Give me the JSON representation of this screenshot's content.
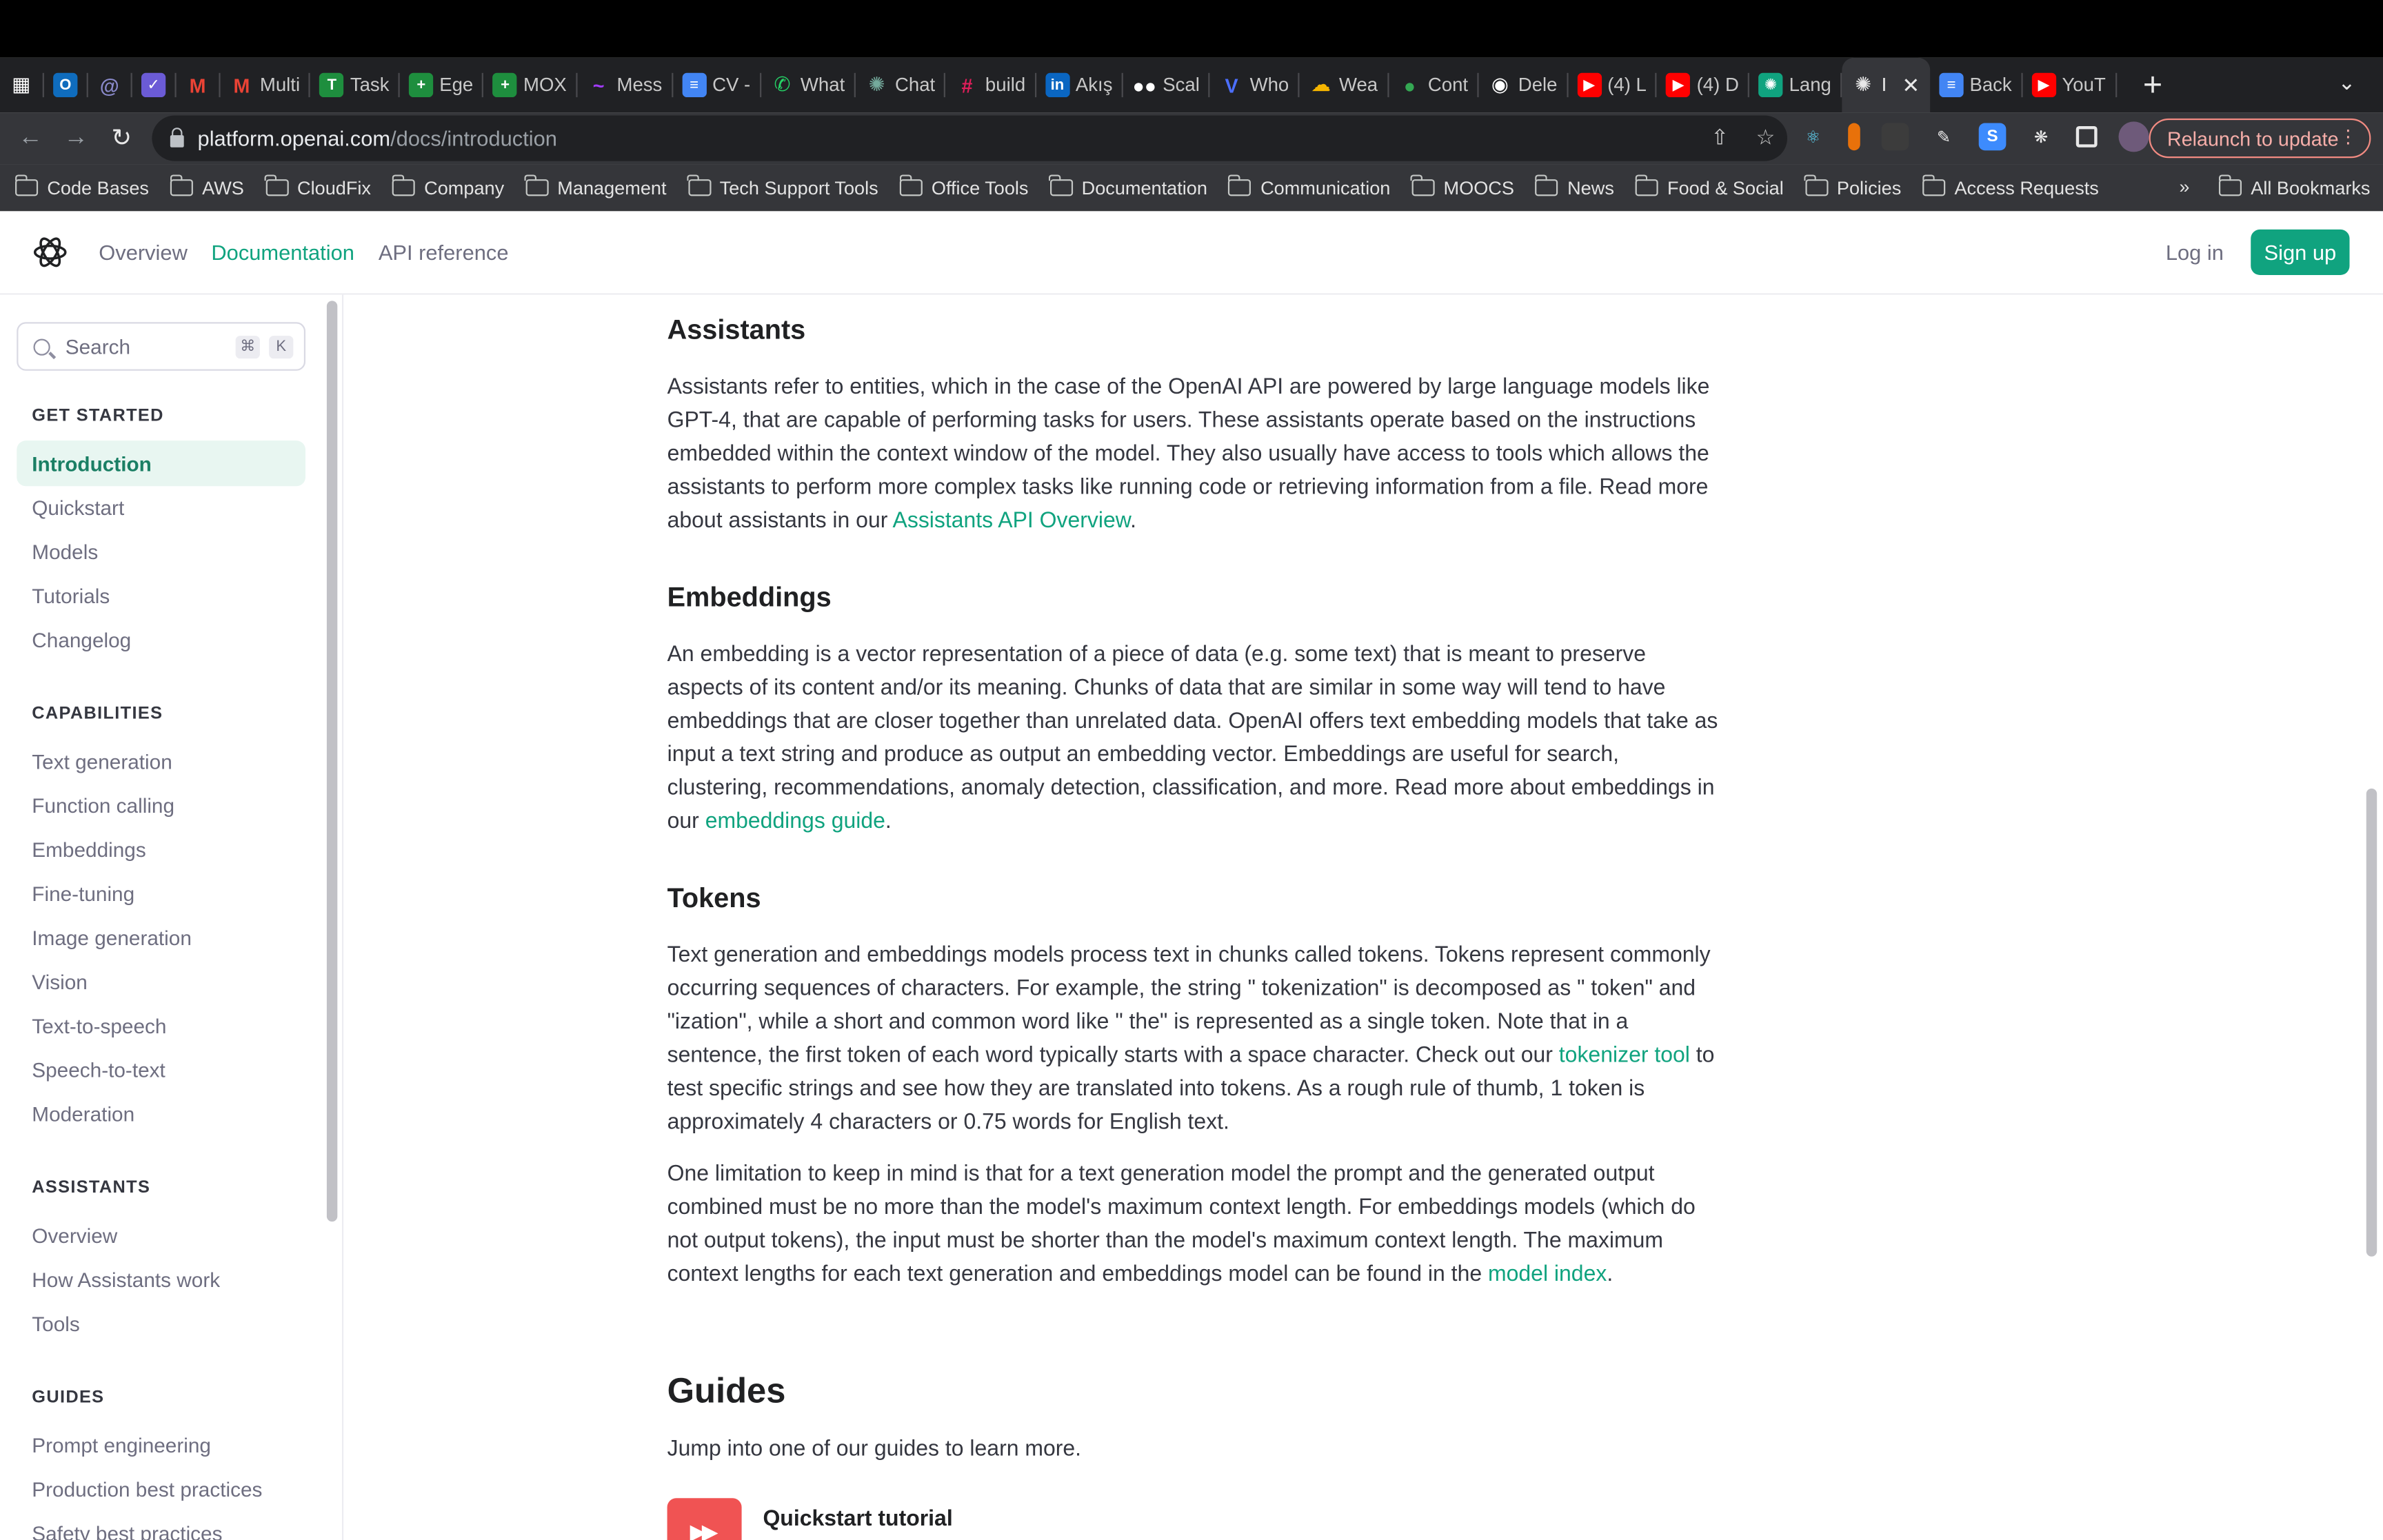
{
  "browser": {
    "tabs": [
      {
        "label": "",
        "icon": "grid-apps-icon",
        "color": "#ffffff"
      },
      {
        "label": "",
        "icon": "outlook-icon",
        "color": "#0f6cbd"
      },
      {
        "label": "",
        "icon": "spiral-icon",
        "color": "#8a8acb"
      },
      {
        "label": "",
        "icon": "check-circle-icon",
        "color": "#6b5bd6"
      },
      {
        "label": "",
        "icon": "gmail-icon",
        "color": "#ea4335"
      },
      {
        "label": "Multi",
        "icon": "gmail-icon",
        "color": "#ea4335"
      },
      {
        "label": "Task",
        "icon": "sheet-t-icon",
        "color": "#1e8e3e"
      },
      {
        "label": "Ege",
        "icon": "sheets-plus-icon",
        "color": "#1e8e3e"
      },
      {
        "label": "MOX",
        "icon": "sheets-plus-icon",
        "color": "#1e8e3e"
      },
      {
        "label": "Mess",
        "icon": "messenger-icon",
        "color": "#a33bff"
      },
      {
        "label": "CV -",
        "icon": "docs-icon",
        "color": "#4285f4"
      },
      {
        "label": "What",
        "icon": "whatsapp-icon",
        "color": "#25d366"
      },
      {
        "label": "Chat",
        "icon": "chatgpt-icon",
        "color": "#74aa9c"
      },
      {
        "label": "build",
        "icon": "slack-icon",
        "color": "#e01e5a"
      },
      {
        "label": "Akış",
        "icon": "linkedin-icon",
        "color": "#0a66c2"
      },
      {
        "label": "Scal",
        "icon": "medium-icon",
        "color": "#ffffff"
      },
      {
        "label": "Who",
        "icon": "check-v-icon",
        "color": "#4c6fff"
      },
      {
        "label": "Wea",
        "icon": "weather-icon",
        "color": "#f4b400"
      },
      {
        "label": "Cont",
        "icon": "green-dot-icon",
        "color": "#34a853"
      },
      {
        "label": "Dele",
        "icon": "github-icon",
        "color": "#ffffff"
      },
      {
        "label": "(4) L",
        "icon": "youtube-icon",
        "color": "#ff0000"
      },
      {
        "label": "(4) D",
        "icon": "youtube-icon",
        "color": "#ff0000"
      },
      {
        "label": "Lang",
        "icon": "chatgpt-green-icon",
        "color": "#10a37f"
      }
    ],
    "active_tab": {
      "label": "I",
      "icon": "openai-icon"
    },
    "tabs_after": [
      {
        "label": "Back",
        "icon": "docs-icon",
        "color": "#4285f4"
      },
      {
        "label": "YouT",
        "icon": "youtube-icon",
        "color": "#ff0000"
      }
    ],
    "url_host": "platform.openai.com",
    "url_path": "/docs/introduction",
    "relaunch_label": "Relaunch to update",
    "bookmarks": [
      "Code Bases",
      "AWS",
      "CloudFix",
      "Company",
      "Management",
      "Tech Support Tools",
      "Office Tools",
      "Documentation",
      "Communication",
      "MOOCS",
      "News",
      "Food & Social",
      "Policies",
      "Access Requests"
    ],
    "bookmarks_more": "»",
    "all_bookmarks": "All Bookmarks"
  },
  "header": {
    "nav": [
      "Overview",
      "Documentation",
      "API reference"
    ],
    "active_nav": "Documentation",
    "login": "Log in",
    "signup": "Sign up",
    "brand_color": "#10a37f"
  },
  "sidebar": {
    "search_placeholder": "Search",
    "shortcut_cmd": "⌘",
    "shortcut_key": "K",
    "sections": [
      {
        "title": "GET STARTED",
        "items": [
          "Introduction",
          "Quickstart",
          "Models",
          "Tutorials",
          "Changelog"
        ]
      },
      {
        "title": "CAPABILITIES",
        "items": [
          "Text generation",
          "Function calling",
          "Embeddings",
          "Fine-tuning",
          "Image generation",
          "Vision",
          "Text-to-speech",
          "Speech-to-text",
          "Moderation"
        ]
      },
      {
        "title": "ASSISTANTS",
        "items": [
          "Overview",
          "How Assistants work",
          "Tools"
        ]
      },
      {
        "title": "GUIDES",
        "items": [
          "Prompt engineering",
          "Production best practices",
          "Safety best practices"
        ]
      }
    ],
    "active_item": "Introduction"
  },
  "main": {
    "assistants": {
      "heading": "Assistants",
      "text": "Assistants refer to entities, which in the case of the OpenAI API are powered by large language models like GPT-4, that are capable of performing tasks for users. These assistants operate based on the instructions embedded within the context window of the model. They also usually have access to tools which allows the assistants to perform more complex tasks like running code or retrieving information from a file. Read more about assistants in our ",
      "link": "Assistants API Overview",
      "after": "."
    },
    "embeddings": {
      "heading": "Embeddings",
      "text": "An embedding is a vector representation of a piece of data (e.g. some text) that is meant to preserve aspects of its content and/or its meaning. Chunks of data that are similar in some way will tend to have embeddings that are closer together than unrelated data. OpenAI offers text embedding models that take as input a text string and produce as output an embedding vector. Embeddings are useful for search, clustering, recommendations, anomaly detection, classification, and more. Read more about embeddings in our ",
      "link": "embeddings guide",
      "after": "."
    },
    "tokens": {
      "heading": "Tokens",
      "text1": "Text generation and embeddings models process text in chunks called tokens. Tokens represent commonly occurring sequences of characters. For example, the string \" tokenization\" is decomposed as \" token\" and \"ization\", while a short and common word like \" the\" is represented as a single token. Note that in a sentence, the first token of each word typically starts with a space character. Check out our ",
      "link1": "tokenizer tool",
      "text1b": " to test specific strings and see how they are translated into tokens. As a rough rule of thumb, 1 token is approximately 4 characters or 0.75 words for English text.",
      "text2": "One limitation to keep in mind is that for a text generation model the prompt and the generated output combined must be no more than the model's maximum context length. For embeddings models (which do not output tokens), the input must be shorter than the model's maximum context length. The maximum context lengths for each text generation and embeddings model can be found in the ",
      "link2": "model index",
      "after2": "."
    },
    "guides": {
      "heading": "Guides",
      "intro": "Jump into one of our guides to learn more.",
      "first_card": "Quickstart tutorial",
      "first_card_icon_color": "#f05353"
    }
  }
}
